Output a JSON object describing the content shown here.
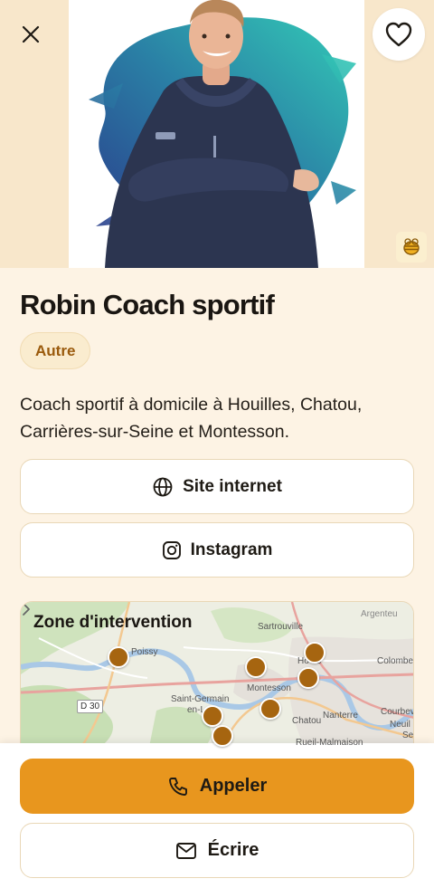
{
  "profile": {
    "name": "Robin Coach sportif",
    "category": "Autre",
    "description": "Coach sportif à domicile à Houilles, Chatou, Carrières-sur-Seine et Montesson."
  },
  "links": {
    "website_label": "Site internet",
    "instagram_label": "Instagram"
  },
  "map": {
    "title": "Zone d'intervention",
    "places": [
      "Sartrouville",
      "Argenteuil",
      "Poissy",
      "Houilles",
      "Colombes",
      "D 30",
      "Montesson",
      "Saint-Germain-en-Laye",
      "Chatou",
      "Nanterre",
      "Courbevoie",
      "Neuilly-sur-Seine",
      "Rueil-Malmaison"
    ],
    "place_labels": {
      "sartrouville": "Sartrouville",
      "argenteuil": "Argenteu",
      "poissy": "Poissy",
      "houilles": "Ho    es",
      "colombes": "Colombe",
      "d30": "D 30",
      "montesson": "Montesson",
      "saint_germain_1": "Saint-Germain",
      "saint_germain_2": "en-L",
      "chatou": "Chatou",
      "nanterre": "Nanterre",
      "courbevoie": "Courbev",
      "neuilly": "Neuil",
      "se": "Se",
      "rueil": "Rueil-Malmaison"
    },
    "pin_count": 7
  },
  "actions": {
    "call_label": "Appeler",
    "write_label": "Écrire"
  },
  "icons": {
    "close": "close-icon",
    "favorite": "heart-icon",
    "badge": "bee-icon",
    "globe": "globe-icon",
    "instagram": "instagram-icon",
    "chevron": "chevron-right-icon",
    "phone": "phone-icon",
    "mail": "mail-icon"
  },
  "colors": {
    "background": "#fdf3e4",
    "accent": "#e8961e",
    "tag_text": "#9a5a0c",
    "pin": "#a66510",
    "photo_brush_dark": "#2b3f8c",
    "photo_brush_light": "#2fc1b8"
  }
}
